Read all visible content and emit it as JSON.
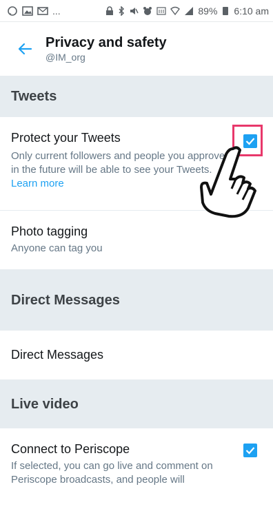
{
  "status_bar": {
    "ellipsis": "...",
    "battery": "89%",
    "time": "6:10 am"
  },
  "header": {
    "title": "Privacy and safety",
    "handle": "@IM_org"
  },
  "sections": {
    "tweets": {
      "title": "Tweets",
      "protect": {
        "title": "Protect your Tweets",
        "desc_prefix": "Only current followers and people you approve in the future will be able to see your Tweets. ",
        "learn_more": "Learn more",
        "checked": true
      },
      "photo_tagging": {
        "title": "Photo tagging",
        "desc": "Anyone can tag you"
      }
    },
    "direct_messages": {
      "title": "Direct Messages",
      "row_title": "Direct Messages"
    },
    "live_video": {
      "title": "Live video",
      "periscope": {
        "title": "Connect to Periscope",
        "desc": "If selected, you can go live and comment on Periscope broadcasts, and people will",
        "checked": true
      }
    }
  },
  "colors": {
    "accent": "#1da1f2",
    "highlight": "#e8386b",
    "section_bg": "#e6ecf0"
  }
}
